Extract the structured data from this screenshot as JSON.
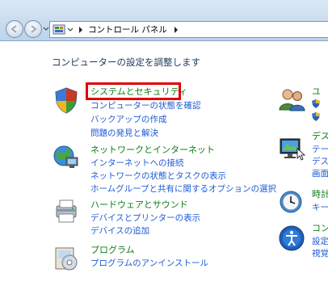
{
  "window": {
    "address_breadcrumb": "コントロール パネル"
  },
  "main": {
    "heading": "コンピューターの設定を調整します",
    "categories": [
      {
        "title": "システムとセキュリティ",
        "links": [
          "コンピューターの状態を確認",
          "バックアップの作成",
          "問題の発見と解決"
        ]
      },
      {
        "title": "ネットワークとインターネット",
        "links": [
          "インターネットへの接続",
          "ネットワークの状態とタスクの表示",
          "ホームグループと共有に関するオプションの選択"
        ]
      },
      {
        "title": "ハードウェアとサウンド",
        "links": [
          "デバイスとプリンターの表示",
          "デバイスの追加"
        ]
      },
      {
        "title": "プログラム",
        "links": [
          "プログラムのアンインストール"
        ]
      }
    ],
    "right_categories": [
      {
        "title": "ユ",
        "links": [
          "",
          ""
        ]
      },
      {
        "title": "デス",
        "links": [
          "テー",
          "デス",
          "画面"
        ]
      },
      {
        "title": "時計",
        "links": [
          "キー"
        ]
      },
      {
        "title": "コン",
        "links": [
          "設定",
          "視覚"
        ]
      }
    ]
  },
  "colors": {
    "highlight": "#e30000",
    "category_title": "#0f7d1a",
    "link": "#1e5bd4"
  }
}
